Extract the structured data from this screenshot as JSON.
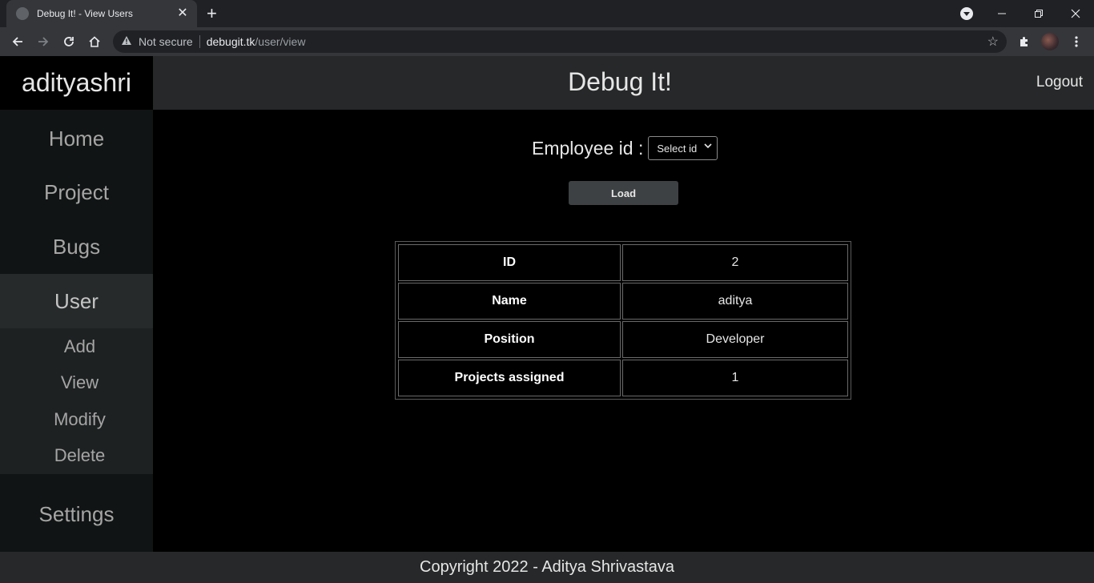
{
  "browser": {
    "tab_title": "Debug It! - View Users",
    "tab_close": "✕",
    "new_tab": "+",
    "security_label": "Not secure",
    "url_host": "debugit.tk",
    "url_path": "/user/view"
  },
  "app": {
    "username": "adityashri",
    "site_title": "Debug It!",
    "logout": "Logout"
  },
  "sidebar": {
    "items": [
      {
        "label": "Home"
      },
      {
        "label": "Project"
      },
      {
        "label": "Bugs"
      },
      {
        "label": "User"
      },
      {
        "label": "Settings"
      }
    ],
    "user_submenu": [
      {
        "label": "Add"
      },
      {
        "label": "View"
      },
      {
        "label": "Modify"
      },
      {
        "label": "Delete"
      }
    ]
  },
  "form": {
    "employee_label": "Employee id :",
    "select_value": "Select id",
    "load_label": "Load"
  },
  "user_table": {
    "rows": [
      {
        "key": "ID",
        "value": "2"
      },
      {
        "key": "Name",
        "value": "aditya"
      },
      {
        "key": "Position",
        "value": "Developer"
      },
      {
        "key": "Projects assigned",
        "value": "1"
      }
    ]
  },
  "footer": {
    "copyright": "Copyright 2022 - Aditya Shrivastava"
  }
}
